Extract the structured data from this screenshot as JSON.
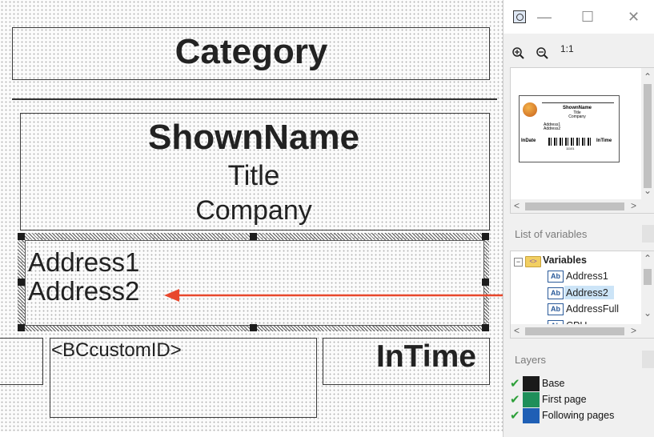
{
  "canvas": {
    "category_text": "Category",
    "shown_name_text": "ShownName",
    "title_text": "Title",
    "company_text": "Company",
    "address1_text": "Address1",
    "address2_text": "Address2",
    "bc_custom_text": "<BCcustomID>",
    "intime_text": "InTime"
  },
  "panel": {
    "titlebar": {
      "minimize": "—",
      "maximize": "☐",
      "close": "✕"
    },
    "toolbar": {
      "zoom_in_icon": "zoom-in",
      "zoom_out_icon": "zoom-out",
      "one_to_one_label": "1:1"
    },
    "preview": {
      "shown_name": "ShownName",
      "title": "Title",
      "company": "Company",
      "address1": "Address1",
      "address2": "Address2",
      "in_date": "InDate",
      "in_time": "InTime",
      "barcode_text": "11101"
    },
    "variables": {
      "header": "List of variables",
      "root_label": "Variables",
      "items": [
        {
          "label": "Address1",
          "icon": "Ab"
        },
        {
          "label": "Address2",
          "icon": "Ab"
        },
        {
          "label": "AddressFull",
          "icon": "Ab"
        },
        {
          "label": "CPU",
          "icon": "Ab"
        }
      ],
      "expander": "−",
      "selected_index": 1
    },
    "layers": {
      "header": "Layers",
      "items": [
        {
          "label": "Base",
          "color": "#1a1a1a"
        },
        {
          "label": "First page",
          "color": "#1f8f5a"
        },
        {
          "label": "Following pages",
          "color": "#1f5fb5"
        }
      ]
    }
  },
  "colors": {
    "arrow": "#e8472c",
    "selection": "#cce4f7"
  }
}
